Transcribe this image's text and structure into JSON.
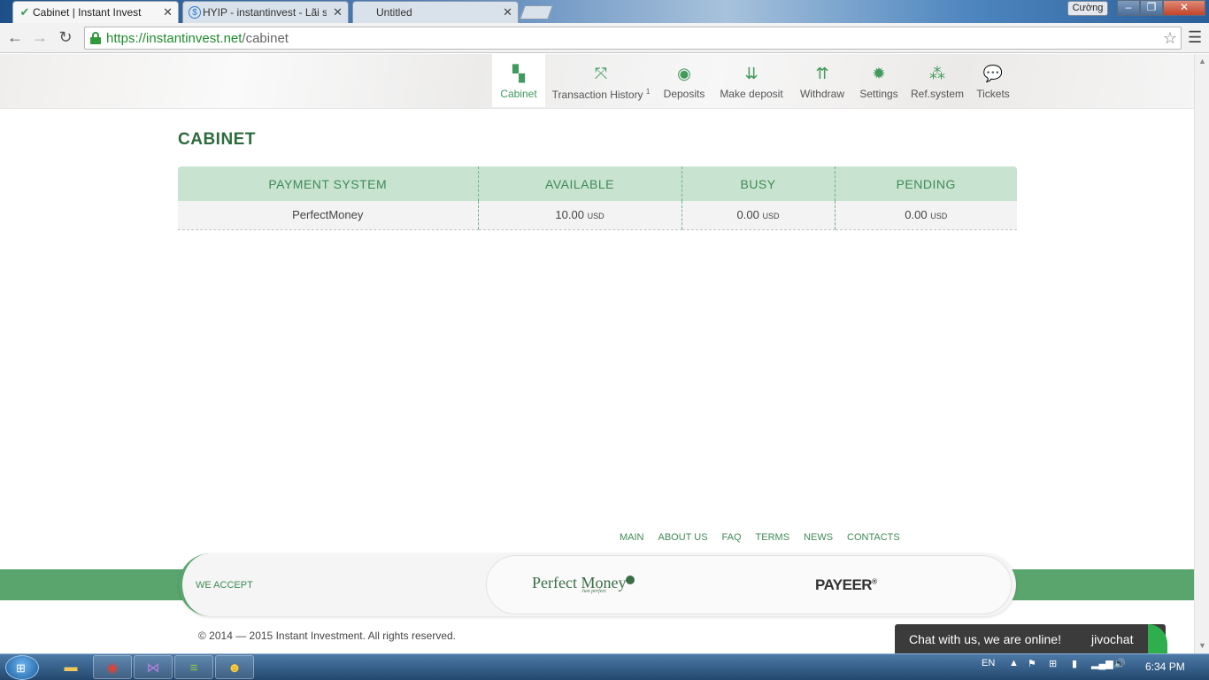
{
  "browser": {
    "tabs": [
      {
        "label": "Cabinet | Instant Invest",
        "favicon": "check-icon",
        "active": true
      },
      {
        "label": "HYIP - instantinvest - Lãi s",
        "favicon": "dollar-icon",
        "active": false
      },
      {
        "label": "Untitled",
        "favicon": "",
        "active": false
      }
    ],
    "user_name": "Cường",
    "url_host": "https://instantinvest.net",
    "url_path": "/cabinet"
  },
  "nav": {
    "items": [
      {
        "label": "Cabinet",
        "icon": "grid-icon"
      },
      {
        "label": "Transaction History",
        "sup": "1",
        "icon": "arrows-expand-icon"
      },
      {
        "label": "Deposits",
        "icon": "coin-icon"
      },
      {
        "label": "Make deposit",
        "icon": "download-icon"
      },
      {
        "label": "Withdraw",
        "icon": "upload-icon"
      },
      {
        "label": "Settings",
        "icon": "gear-icon"
      },
      {
        "label": "Ref.system",
        "icon": "hierarchy-icon"
      },
      {
        "label": "Tickets",
        "icon": "chat-bubble-icon"
      }
    ]
  },
  "page": {
    "title": "CABINET",
    "table": {
      "headers": [
        "PAYMENT SYSTEM",
        "AVAILABLE",
        "BUSY",
        "PENDING"
      ],
      "rows": [
        {
          "system": "PerfectMoney",
          "available": "10.00",
          "busy": "0.00",
          "pending": "0.00",
          "unit": "USD"
        }
      ]
    }
  },
  "footer": {
    "links": [
      "MAIN",
      "ABOUT US",
      "FAQ",
      "TERMS",
      "NEWS",
      "CONTACTS"
    ],
    "we_accept": "WE ACCEPT",
    "perfect_money": "Perfect Money",
    "perfect_money_tag": "Just perfect",
    "payeer": "PAYEER",
    "payeer_mark": "®",
    "copyright": "© 2014 — 2015 Instant Investment. All rights reserved."
  },
  "chat": {
    "message": "Chat with us, we are online!",
    "brand": "jivochat"
  },
  "taskbar": {
    "language": "EN",
    "time": "6:34 PM"
  },
  "colors": {
    "brand_green": "#3f9a5c",
    "header_row": "#c8e3cf",
    "busy_red": "#c0392b",
    "pending_gold": "#a98625"
  }
}
